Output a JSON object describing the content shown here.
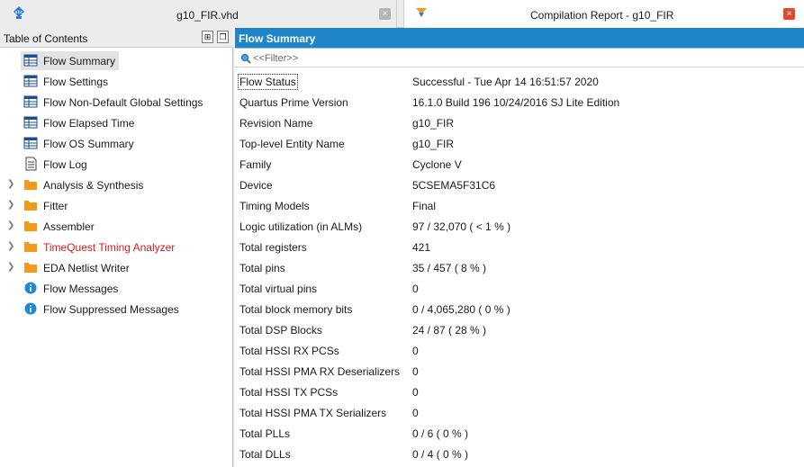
{
  "tabs": [
    {
      "title": "g10_FIR.vhd",
      "icon": "vhdl-file-icon",
      "close": "×"
    },
    {
      "title": "Compilation Report - g10_FIR",
      "icon": "compilation-report-icon",
      "close": "×"
    }
  ],
  "toc": {
    "title": "Table of Contents",
    "pin_button": "⊞",
    "float_button": "❐",
    "items": [
      {
        "label": "Flow Summary",
        "icon": "table-icon",
        "selected": true,
        "expandable": false
      },
      {
        "label": "Flow Settings",
        "icon": "table-icon",
        "expandable": false
      },
      {
        "label": "Flow Non-Default Global Settings",
        "icon": "table-icon",
        "expandable": false
      },
      {
        "label": "Flow Elapsed Time",
        "icon": "table-icon",
        "expandable": false
      },
      {
        "label": "Flow OS Summary",
        "icon": "table-icon",
        "expandable": false
      },
      {
        "label": "Flow Log",
        "icon": "document-icon",
        "expandable": false
      },
      {
        "label": "Analysis & Synthesis",
        "icon": "folder-icon",
        "expandable": true
      },
      {
        "label": "Fitter",
        "icon": "folder-icon",
        "expandable": true
      },
      {
        "label": "Assembler",
        "icon": "folder-icon",
        "expandable": true
      },
      {
        "label": "TimeQuest Timing Analyzer",
        "icon": "folder-icon",
        "expandable": true,
        "color": "#d41c1c"
      },
      {
        "label": "EDA Netlist Writer",
        "icon": "folder-icon",
        "expandable": true
      },
      {
        "label": "Flow Messages",
        "icon": "info-icon",
        "expandable": false
      },
      {
        "label": "Flow Suppressed Messages",
        "icon": "info-icon",
        "expandable": false
      }
    ]
  },
  "report": {
    "title": "Flow Summary",
    "filter_placeholder": "<<Filter>>",
    "rows": [
      {
        "key": "Flow Status",
        "value": "Successful - Tue Apr 14 16:51:57 2020"
      },
      {
        "key": "Quartus Prime Version",
        "value": "16.1.0 Build 196 10/24/2016 SJ Lite Edition"
      },
      {
        "key": "Revision Name",
        "value": "g10_FIR"
      },
      {
        "key": "Top-level Entity Name",
        "value": "g10_FIR"
      },
      {
        "key": "Family",
        "value": "Cyclone V"
      },
      {
        "key": "Device",
        "value": "5CSEMA5F31C6"
      },
      {
        "key": "Timing Models",
        "value": "Final"
      },
      {
        "key": "Logic utilization (in ALMs)",
        "value": "97 / 32,070 ( < 1 % )"
      },
      {
        "key": "Total registers",
        "value": "421"
      },
      {
        "key": "Total pins",
        "value": "35 / 457 ( 8 % )"
      },
      {
        "key": "Total virtual pins",
        "value": "0"
      },
      {
        "key": "Total block memory bits",
        "value": "0 / 4,065,280 ( 0 % )"
      },
      {
        "key": "Total DSP Blocks",
        "value": "24 / 87 ( 28 % )"
      },
      {
        "key": "Total HSSI RX PCSs",
        "value": "0"
      },
      {
        "key": "Total HSSI PMA RX Deserializers",
        "value": "0"
      },
      {
        "key": "Total HSSI TX PCSs",
        "value": "0"
      },
      {
        "key": "Total HSSI PMA TX Serializers",
        "value": "0"
      },
      {
        "key": "Total PLLs",
        "value": "0 / 6 ( 0 % )"
      },
      {
        "key": "Total DLLs",
        "value": "0 / 4 ( 0 % )"
      }
    ]
  },
  "colors": {
    "header_blue": "#1e86c8",
    "folder_orange": "#f29a1a",
    "info_blue": "#1f88d6",
    "error_red": "#d41c1c",
    "close_red": "#e04b2c"
  }
}
